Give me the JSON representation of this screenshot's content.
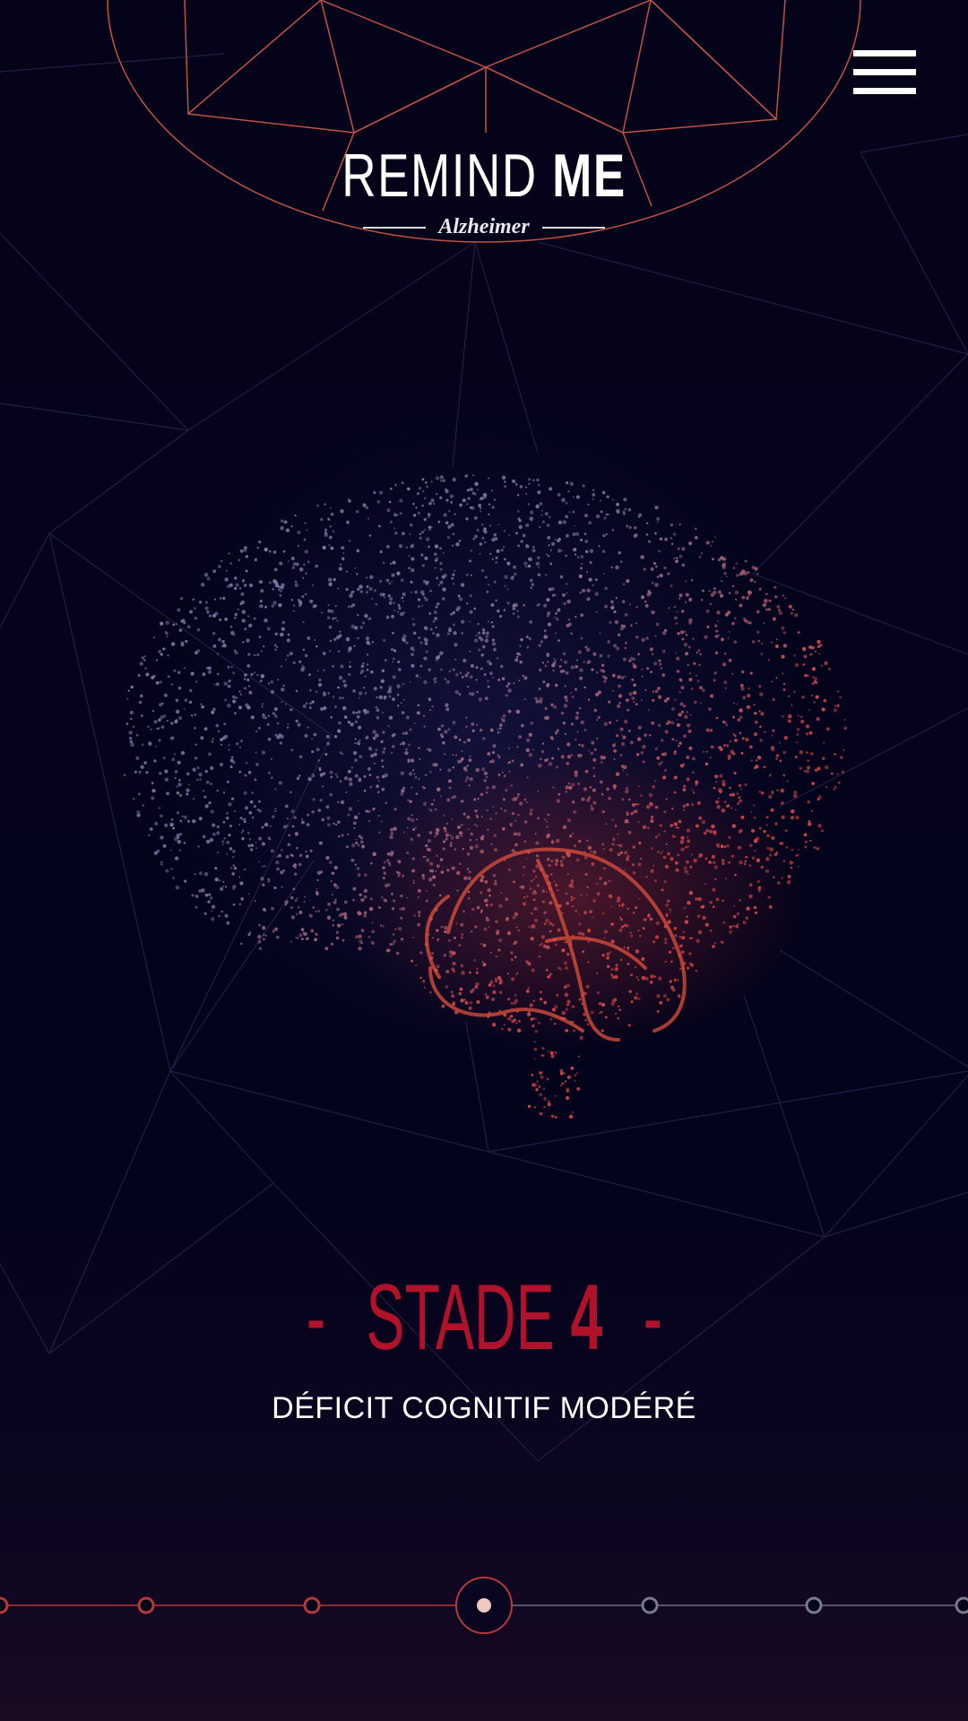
{
  "header": {
    "menu_icon": "hamburger-menu-icon",
    "logo": {
      "title_light": "REMIND",
      "title_bold": "ME",
      "subtitle": "Alzheimer"
    }
  },
  "stage": {
    "prefix_dash": "-",
    "label": "STADE",
    "number": "4",
    "suffix_dash": "-",
    "subtitle": "DÉFICIT COGNITIF MODÉRÉ"
  },
  "timeline": {
    "total_stages": 7,
    "current_stage": 4
  },
  "colors": {
    "background": "#03021a",
    "accent_red": "#b0122a",
    "line_coral": "#e0604e",
    "text_white": "#ffffff"
  }
}
